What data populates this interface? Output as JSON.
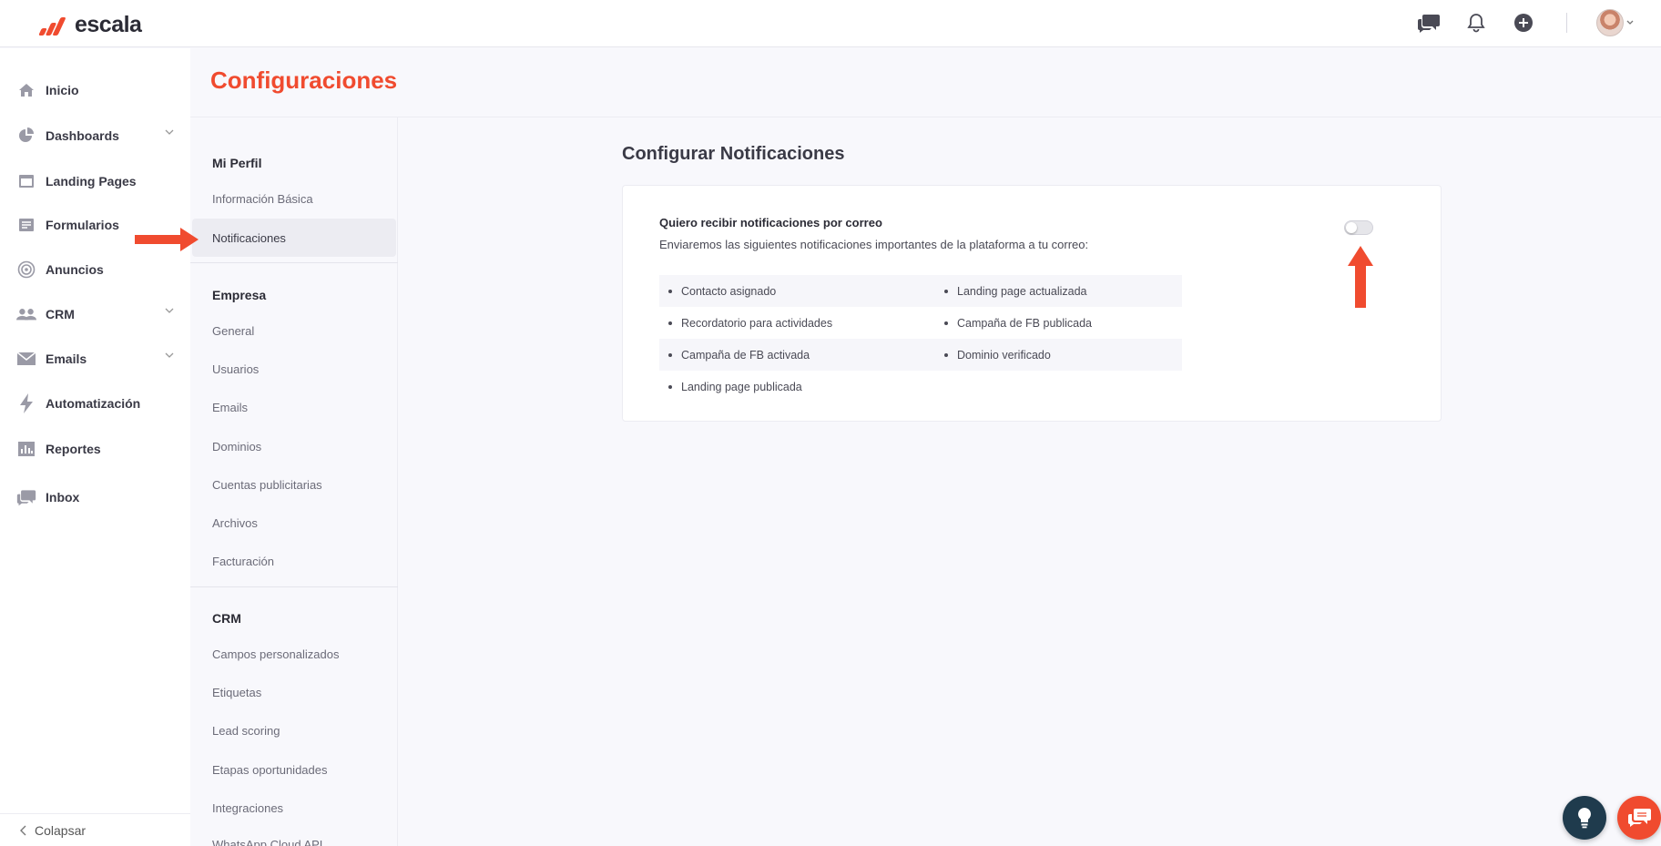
{
  "brand": {
    "name": "escala",
    "accent": "#f04b2f"
  },
  "topbar": {
    "icons": [
      "chat-bubbles-icon",
      "bell-icon",
      "plus-circle-icon"
    ],
    "avatar_alt": "avatar"
  },
  "sidebar": {
    "items": [
      {
        "label": "Inicio",
        "icon": "home-icon",
        "has_chevron": false
      },
      {
        "label": "Dashboards",
        "icon": "pie-chart-icon",
        "has_chevron": true
      },
      {
        "label": "Landing Pages",
        "icon": "browser-window-icon",
        "has_chevron": false
      },
      {
        "label": "Formularios",
        "icon": "form-icon",
        "has_chevron": false
      },
      {
        "label": "Anuncios",
        "icon": "target-icon",
        "has_chevron": false
      },
      {
        "label": "CRM",
        "icon": "users-icon",
        "has_chevron": true
      },
      {
        "label": "Emails",
        "icon": "envelope-icon",
        "has_chevron": true
      },
      {
        "label": "Automatización",
        "icon": "lightning-icon",
        "has_chevron": false
      },
      {
        "label": "Reportes",
        "icon": "bar-chart-icon",
        "has_chevron": false
      },
      {
        "label": "Inbox",
        "icon": "inbox-chat-icon",
        "has_chevron": false
      }
    ],
    "collapse_label": "Colapsar"
  },
  "page": {
    "title": "Configuraciones"
  },
  "subnav": {
    "sections": [
      {
        "title": "Mi Perfil",
        "items": [
          "Información Básica",
          "Notificaciones"
        ]
      },
      {
        "title": "Empresa",
        "items": [
          "General",
          "Usuarios",
          "Emails",
          "Dominios",
          "Cuentas publicitarias",
          "Archivos",
          "Facturación"
        ]
      },
      {
        "title": "CRM",
        "items": [
          "Campos personalizados",
          "Etiquetas",
          "Lead scoring",
          "Etapas oportunidades",
          "Integraciones",
          "WhatsApp Cloud API"
        ]
      }
    ],
    "active_item": "Notificaciones"
  },
  "content": {
    "title": "Configurar Notificaciones",
    "card": {
      "heading": "Quiero recibir notificaciones por correo",
      "description": "Enviaremos las siguientes notificaciones importantes de la plataforma a tu correo:",
      "toggle_on": false,
      "notifications": [
        [
          "Contacto asignado",
          "Landing page actualizada"
        ],
        [
          "Recordatorio para actividades",
          "Campaña de FB publicada"
        ],
        [
          "Campaña de FB activada",
          "Dominio verificado"
        ],
        [
          "Landing page publicada",
          ""
        ]
      ]
    }
  }
}
